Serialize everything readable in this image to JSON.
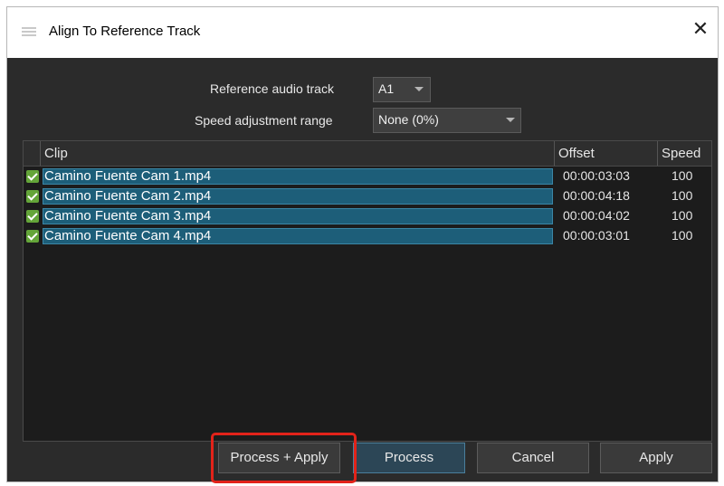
{
  "window": {
    "title": "Align To Reference Track",
    "close_glyph": "✕",
    "icon": "app-menu-icon"
  },
  "form": {
    "reference_label": "Reference audio track",
    "reference_value": "A1",
    "speed_label": "Speed adjustment range",
    "speed_value": "None (0%)"
  },
  "table": {
    "headers": {
      "clip": "Clip",
      "offset": "Offset",
      "speed": "Speed"
    },
    "rows": [
      {
        "checked": true,
        "clip": "Camino Fuente Cam 1.mp4",
        "offset": "00:00:03:03",
        "speed": "100"
      },
      {
        "checked": true,
        "clip": "Camino Fuente Cam 2.mp4",
        "offset": "00:00:04:18",
        "speed": "100"
      },
      {
        "checked": true,
        "clip": "Camino Fuente Cam 3.mp4",
        "offset": "00:00:04:02",
        "speed": "100"
      },
      {
        "checked": true,
        "clip": "Camino Fuente Cam 4.mp4",
        "offset": "00:00:03:01",
        "speed": "100"
      }
    ]
  },
  "buttons": {
    "process_apply": "Process + Apply",
    "process": "Process",
    "cancel": "Cancel",
    "apply": "Apply"
  },
  "colors": {
    "highlight": "#e2231a",
    "selection": "#1d5e79",
    "check": "#64a539"
  }
}
